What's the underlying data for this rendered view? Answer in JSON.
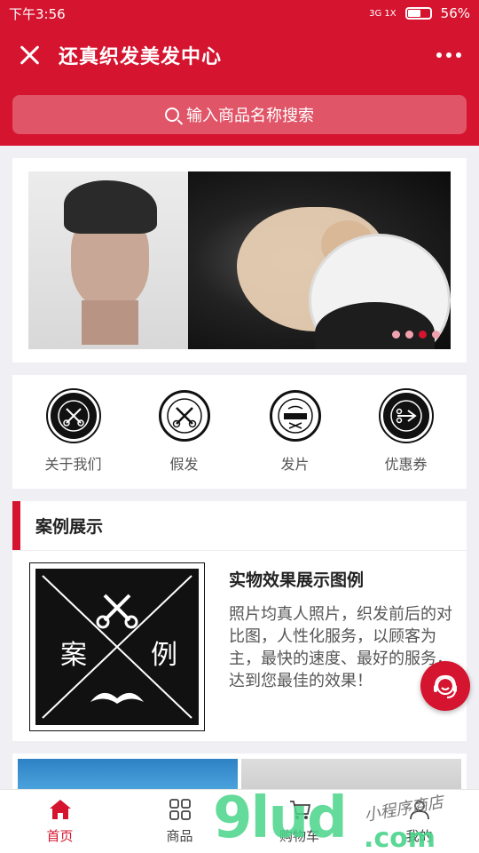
{
  "status": {
    "time": "下午3:56",
    "network": "3G 1X",
    "battery": "56%"
  },
  "header": {
    "title": "还真织发美发中心"
  },
  "search": {
    "placeholder": "输入商品名称搜索"
  },
  "banner": {
    "dots": 4,
    "active_dot": 3
  },
  "categories": [
    {
      "label": "关于我们",
      "icon": "barber-scissors-badge"
    },
    {
      "label": "假发",
      "icon": "wig-scissors-badge"
    },
    {
      "label": "发片",
      "icon": "hairpiece-logo-badge"
    },
    {
      "label": "优惠券",
      "icon": "coupon-scissors-badge"
    }
  ],
  "cases": {
    "section_title": "案例展示",
    "item_title": "实物效果展示图例",
    "item_desc": "照片均真人照片，织发前后的对比图，人性化服务，以顾客为主，最快的速度、最好的服务，达到您最佳的效果！",
    "image_chars": [
      "案",
      "例"
    ]
  },
  "tabbar": {
    "items": [
      {
        "label": "首页",
        "icon": "home-icon",
        "active": true
      },
      {
        "label": "商品",
        "icon": "grid-icon",
        "active": false
      },
      {
        "label": "购物车",
        "icon": "cart-icon",
        "active": false
      },
      {
        "label": "我的",
        "icon": "user-icon",
        "active": false
      }
    ]
  },
  "watermark": {
    "main": "9lud",
    "suffix": ".com",
    "small": "小程序商店"
  },
  "colors": {
    "brand": "#d5142f",
    "text": "#222222",
    "subtext": "#555555"
  }
}
